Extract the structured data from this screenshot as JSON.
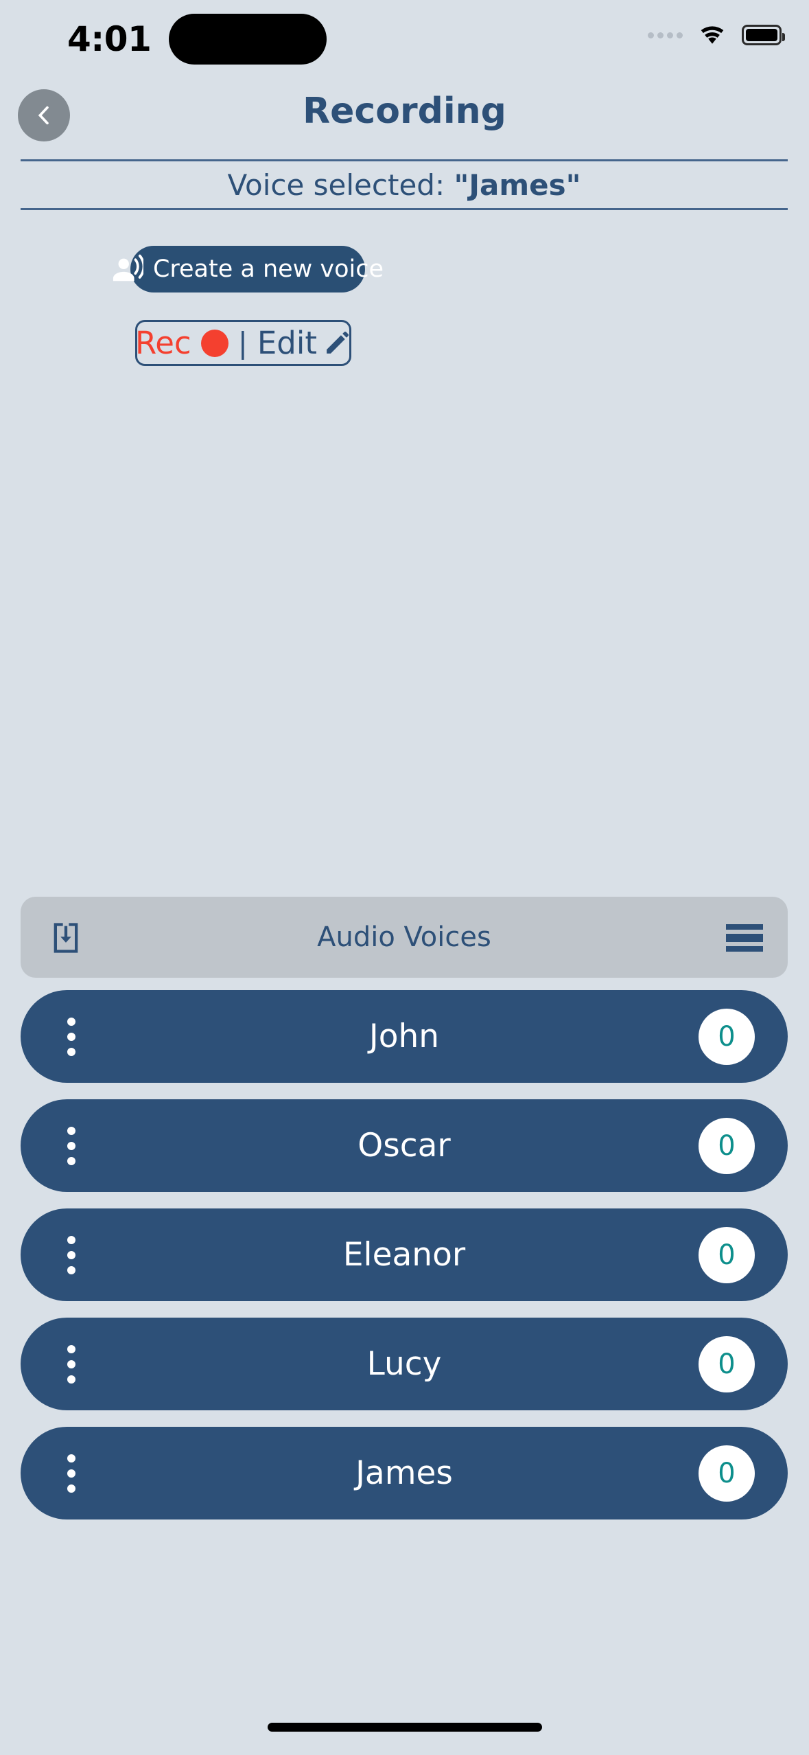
{
  "statusbar": {
    "time": "4:01",
    "cellular_icon": "cellular-dots-icon",
    "wifi_icon": "wifi-icon",
    "battery_icon": "battery-full-icon"
  },
  "header": {
    "back_icon": "chevron-left-icon",
    "title": "Recording"
  },
  "voice_selected": {
    "label": "Voice selected: ",
    "value": "\"James\""
  },
  "create_voice_button": {
    "label": "Create a new voice",
    "icon": "record-voice-over-icon"
  },
  "rec_edit_pill": {
    "rec_label": "Rec",
    "rec_dot_icon": "record-dot-icon",
    "separator": "|",
    "edit_label": "Edit",
    "edit_icon": "pencil-icon"
  },
  "audio_bar": {
    "import_icon": "download-import-icon",
    "title": "Audio Voices",
    "menu_icon": "hamburger-menu-icon"
  },
  "voices": [
    {
      "kebab_icon": "more-vertical-icon",
      "name": "John",
      "count": "0"
    },
    {
      "kebab_icon": "more-vertical-icon",
      "name": "Oscar",
      "count": "0"
    },
    {
      "kebab_icon": "more-vertical-icon",
      "name": "Eleanor",
      "count": "0"
    },
    {
      "kebab_icon": "more-vertical-icon",
      "name": "Lucy",
      "count": "0"
    },
    {
      "kebab_icon": "more-vertical-icon",
      "name": "James",
      "count": "0"
    }
  ],
  "colors": {
    "background": "#d9e0e7",
    "navy": "#2d5078",
    "navy_button": "#2a4f74",
    "red": "#f4402f",
    "teal": "#0e8f8c",
    "gray_bar": "#bfc5cb",
    "gray_back": "#828a91"
  }
}
